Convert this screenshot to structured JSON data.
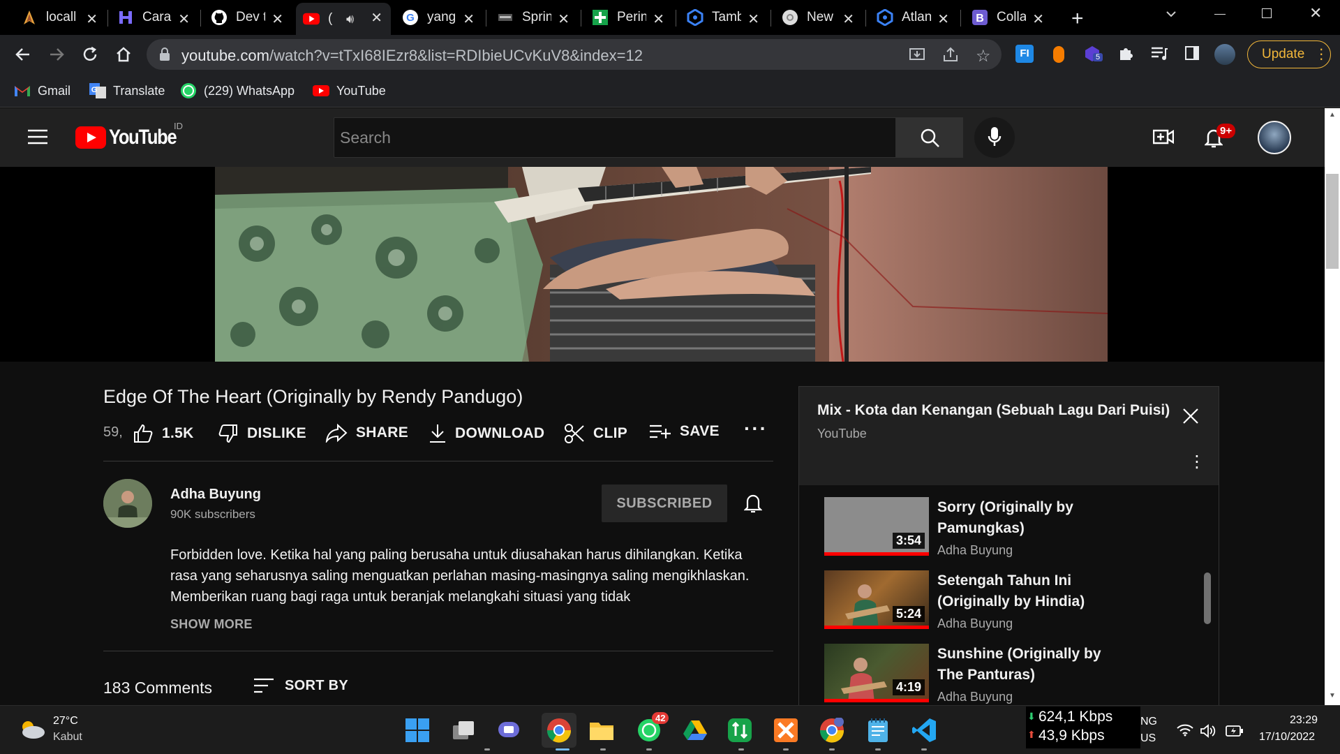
{
  "tabs": [
    {
      "title": "locall",
      "icon": "rocket-icon"
    },
    {
      "title": "Cara",
      "icon": "h-icon"
    },
    {
      "title": "Dev t",
      "icon": "github-icon"
    },
    {
      "title": "(",
      "icon": "youtube-icon"
    },
    {
      "title": "yang",
      "icon": "google-icon"
    },
    {
      "title": "Sprin",
      "icon": "spring-icon"
    },
    {
      "title": "Perin",
      "icon": "plus-icon"
    },
    {
      "title": "Tamb",
      "icon": "hexagon-icon"
    },
    {
      "title": "New",
      "icon": "chrome-icon"
    },
    {
      "title": "Atlan",
      "icon": "hexagon-icon"
    },
    {
      "title": "Colla",
      "icon": "b-icon"
    }
  ],
  "address": {
    "host": "youtube.com",
    "path": "/watch?v=tTxI68IEzr8&list=RDIbieUCvKuV8&index=12"
  },
  "update_label": "Update",
  "extension_badge": "5",
  "bookmarks": [
    "Gmail",
    "Translate",
    "(229) WhatsApp",
    "YouTube"
  ],
  "youtube": {
    "logo_text": "YouTube",
    "region": "ID",
    "search_placeholder": "Search",
    "notifications": "9+"
  },
  "video": {
    "title": "Edge Of The Heart (Originally by Rendy Pandugo)",
    "views": "59,",
    "likes": "1.5K",
    "dislike": "DISLIKE",
    "share": "SHARE",
    "download": "DOWNLOAD",
    "clip": "CLIP",
    "save": "SAVE"
  },
  "channel": {
    "name": "Adha Buyung",
    "subscribers": "90K subscribers",
    "subscribe_label": "SUBSCRIBED"
  },
  "description": "Forbidden love. Ketika hal yang paling berusaha untuk diusahakan harus dihilangkan. Ketika rasa yang seharusnya saling menguatkan perlahan masing-masingnya saling mengikhlaskan. Memberikan ruang bagi raga untuk beranjak melangkahi situasi yang tidak",
  "show_more": "SHOW MORE",
  "comments": {
    "count": "183 Comments",
    "sort": "SORT BY"
  },
  "playlist": {
    "title": "Mix - Kota dan Kenangan (Sebuah Lagu Dari Puisi)",
    "source": "YouTube",
    "items": [
      {
        "title": "Sorry (Originally by Pamungkas)",
        "channel": "Adha Buyung",
        "duration": "3:54"
      },
      {
        "title": "Setengah Tahun Ini (Originally by Hindia)",
        "channel": "Adha Buyung",
        "duration": "5:24"
      },
      {
        "title": "Sunshine (Originally by The Panturas)",
        "channel": "Adha Buyung",
        "duration": "4:19"
      }
    ]
  },
  "taskbar": {
    "weather_temp": "27°C",
    "weather_desc": "Kabut",
    "whatsapp_badge": "42",
    "net_down": "624,1 Kbps",
    "net_up": "43,9 Kbps",
    "lang_top": "NG",
    "lang_bottom": "US",
    "time": "23:29",
    "date": "17/10/2022"
  }
}
